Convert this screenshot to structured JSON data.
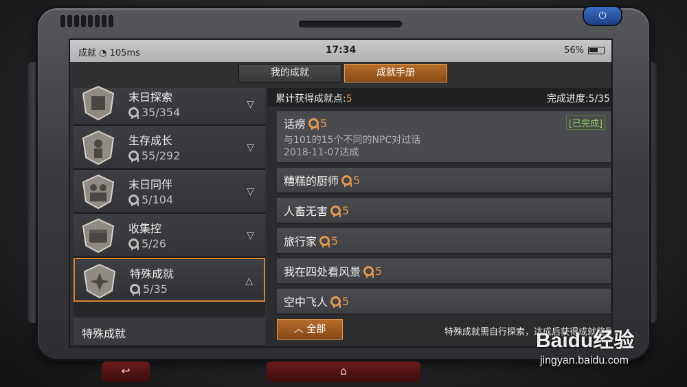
{
  "status": {
    "carrier": "成就",
    "signal": "105ms",
    "time": "17:34",
    "battery": "56%"
  },
  "tabs": [
    {
      "label": "我的成就",
      "active": false
    },
    {
      "label": "成就手册",
      "active": true
    }
  ],
  "categories": [
    {
      "name": "末日探索",
      "count": "35/354",
      "chevron": "down"
    },
    {
      "name": "生存成长",
      "count": "55/292",
      "chevron": "down"
    },
    {
      "name": "末日同伴",
      "count": "5/104",
      "chevron": "down"
    },
    {
      "name": "收集控",
      "count": "5/26",
      "chevron": "down"
    },
    {
      "name": "特殊成就",
      "count": "5/35",
      "chevron": "up"
    }
  ],
  "subcategory": "特殊成就",
  "summary": {
    "total_label": "累计获得成就点:",
    "total_value": "5",
    "progress": "完成进度:5/35"
  },
  "achievements": [
    {
      "name": "话痨",
      "points": "5",
      "status": "[已完成]",
      "desc": "与101的15个不同的NPC对过话",
      "date": "2018-11-07达成"
    },
    {
      "name": "糟糕的厨师",
      "points": "5"
    },
    {
      "name": "人畜无害",
      "points": "5"
    },
    {
      "name": "旅行家",
      "points": "5"
    },
    {
      "name": "我在四处看风景",
      "points": "5"
    },
    {
      "name": "空中飞人",
      "points": "5"
    }
  ],
  "all_button": "全部",
  "note": "特殊成就需自行探索，达成后获得成就奖励",
  "watermark": {
    "brand": "Baidu经验",
    "url": "jingyan.baidu.com"
  },
  "colors": {
    "accent": "#d68436",
    "done": "#8fcf5a",
    "points": "#e59a4d"
  }
}
